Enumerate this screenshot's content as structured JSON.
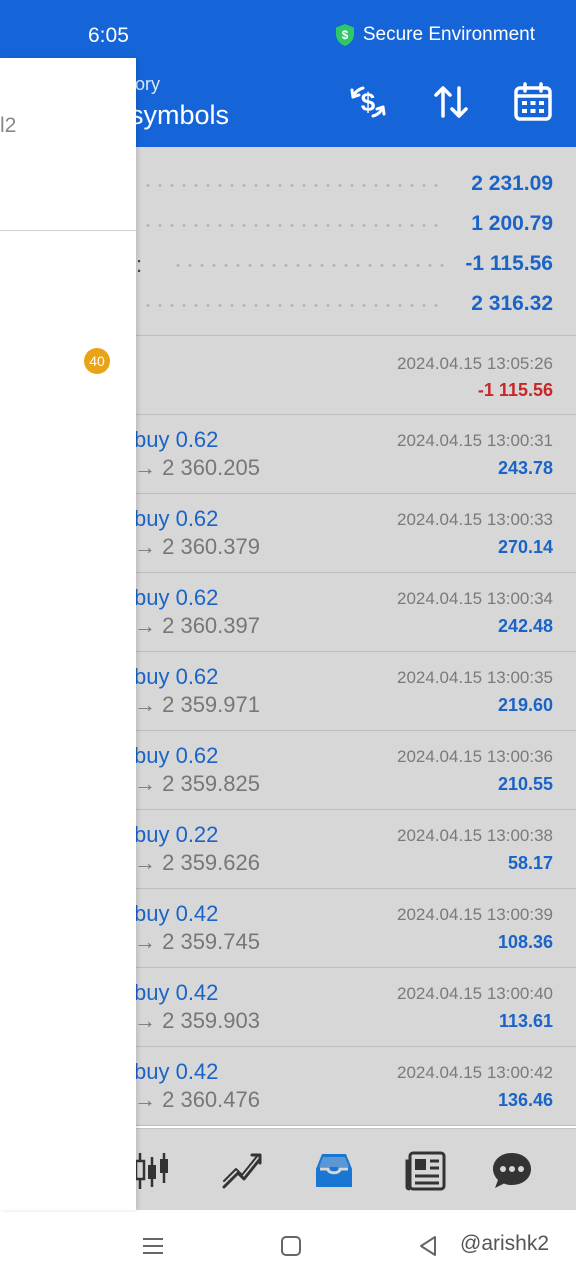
{
  "status_bar": {
    "time": "6:05",
    "secure_label": "Secure Environment",
    "shield_icon": "shield-dollar-icon",
    "shield_color": "#2ec866"
  },
  "toolbar": {
    "title_partial": "ory",
    "subtitle_partial": "symbols",
    "background": "#1565d8",
    "icons": [
      "currency-swap-icon",
      "sort-icon",
      "calendar-icon"
    ]
  },
  "summary": {
    "values": [
      "2 231.09",
      "1 200.79",
      "-1 115.56",
      "2 316.32"
    ],
    "colon": ":"
  },
  "balance_row": {
    "date": "2024.04.15 13:05:26",
    "profit": "-1 115.56"
  },
  "deals": [
    {
      "type": "buy 0.62",
      "price": "→ 2 360.205",
      "date": "2024.04.15 13:00:31",
      "profit": "243.78"
    },
    {
      "type": "buy 0.62",
      "price": "→ 2 360.379",
      "date": "2024.04.15 13:00:33",
      "profit": "270.14"
    },
    {
      "type": "buy 0.62",
      "price": "→ 2 360.397",
      "date": "2024.04.15 13:00:34",
      "profit": "242.48"
    },
    {
      "type": "buy 0.62",
      "price": "→ 2 359.971",
      "date": "2024.04.15 13:00:35",
      "profit": "219.60"
    },
    {
      "type": "buy 0.62",
      "price": "→ 2 359.825",
      "date": "2024.04.15 13:00:36",
      "profit": "210.55"
    },
    {
      "type": "buy 0.22",
      "price": "→ 2 359.626",
      "date": "2024.04.15 13:00:38",
      "profit": "58.17"
    },
    {
      "type": "buy 0.42",
      "price": "→ 2 359.745",
      "date": "2024.04.15 13:00:39",
      "profit": "108.36"
    },
    {
      "type": "buy 0.42",
      "price": "→ 2 359.903",
      "date": "2024.04.15 13:00:40",
      "profit": "113.61"
    },
    {
      "type": "buy 0.42",
      "price": "→ 2 360.476",
      "date": "2024.04.15 13:00:42",
      "profit": "136.46"
    }
  ],
  "drawer": {
    "account_partial": "l2",
    "badge_count": "40",
    "badge_color": "#e8a317"
  },
  "bottom_nav": {
    "items": [
      "quotes-candles-icon",
      "chart-trend-icon",
      "history-inbox-icon",
      "news-icon",
      "chat-icon"
    ],
    "active": "history-inbox-icon"
  },
  "system_nav": {
    "watermark": "@arishk2",
    "buttons": [
      "menu-icon",
      "home-icon",
      "back-icon"
    ]
  },
  "colors": {
    "accent": "#1565d8",
    "positive": "#1a64c8",
    "negative": "#c62828",
    "list_bg": "#d7d7d7"
  }
}
